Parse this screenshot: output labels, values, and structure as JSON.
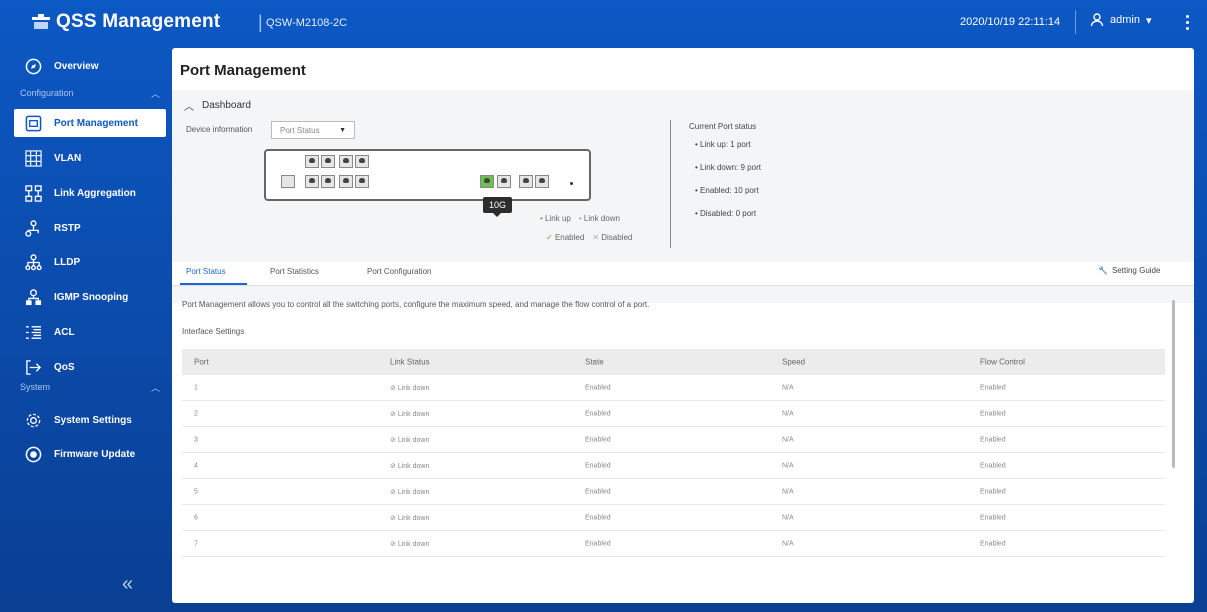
{
  "app": {
    "title": "QSS Management",
    "separator": "|",
    "model": "QSW-M2108-2C",
    "datetime": "2020/10/19 22:11:14",
    "user": "admin",
    "user_caret": "▾"
  },
  "sidebar": {
    "items": [
      {
        "label": "Overview",
        "icon": "compass-icon"
      },
      {
        "label": "Port Management",
        "icon": "port-icon",
        "active": true
      },
      {
        "label": "VLAN",
        "icon": "vlan-icon"
      },
      {
        "label": "Link Aggregation",
        "icon": "link-aggregation-icon"
      },
      {
        "label": "RSTP",
        "icon": "rstp-icon"
      },
      {
        "label": "LLDP",
        "icon": "lldp-icon"
      },
      {
        "label": "IGMP Snooping",
        "icon": "igmp-icon"
      },
      {
        "label": "ACL",
        "icon": "acl-icon"
      },
      {
        "label": "QoS",
        "icon": "qos-icon"
      },
      {
        "label": "System Settings",
        "icon": "gear-icon"
      },
      {
        "label": "Firmware Update",
        "icon": "firmware-icon"
      }
    ],
    "sections": {
      "configuration": "Configuration",
      "system": "System"
    },
    "collapse": "«"
  },
  "page": {
    "title": "Port Management",
    "dashboard_label": "Dashboard",
    "device_info_label": "Device information",
    "device_select_value": "Port Status",
    "tag_10g": "10G",
    "legend": {
      "link_up": "Link up",
      "link_down": "Link down",
      "enabled": "Enabled",
      "disabled": "Disabled"
    },
    "current_status_title": "Current Port status",
    "status": [
      "Link up:  1 port",
      "Link down:  9 port",
      "Enabled:  10 port",
      "Disabled:  0 port"
    ],
    "tabs": [
      "Port Status",
      "Port Statistics",
      "Port Configuration"
    ],
    "setting_guide": "Setting Guide",
    "description": "Port Management allows you to control all the switching ports, configure the maximum speed, and manage the flow control of a port.",
    "interface_settings": "Interface Settings"
  },
  "table": {
    "headers": [
      "Port",
      "Link Status",
      "State",
      "Speed",
      "Flow Control"
    ],
    "rows": [
      [
        "1",
        "Link down",
        "Enabled",
        "N/A",
        "Enabled"
      ],
      [
        "2",
        "Link down",
        "Enabled",
        "N/A",
        "Enabled"
      ],
      [
        "3",
        "Link down",
        "Enabled",
        "N/A",
        "Enabled"
      ],
      [
        "4",
        "Link down",
        "Enabled",
        "N/A",
        "Enabled"
      ],
      [
        "5",
        "Link down",
        "Enabled",
        "N/A",
        "Enabled"
      ],
      [
        "6",
        "Link down",
        "Enabled",
        "N/A",
        "Enabled"
      ],
      [
        "7",
        "Link down",
        "Enabled",
        "N/A",
        "Enabled"
      ]
    ]
  },
  "colors": {
    "brand_blue": "#0c58c4",
    "link_up_green": "#6cc24a",
    "tab_active": "#1a66d6"
  }
}
